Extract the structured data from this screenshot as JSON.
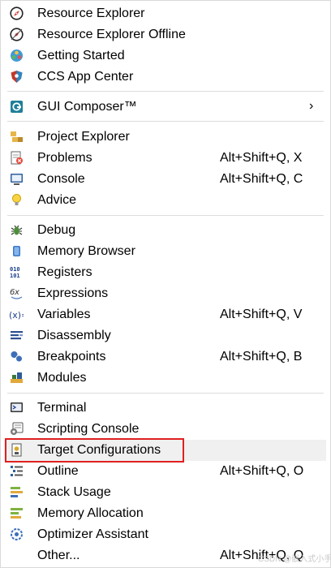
{
  "menu": {
    "items": [
      {
        "label": "Resource Explorer",
        "shortcut": "",
        "icon": "compass-icon"
      },
      {
        "label": "Resource Explorer Offline",
        "shortcut": "",
        "icon": "compass-offline-icon"
      },
      {
        "label": "Getting Started",
        "shortcut": "",
        "icon": "getting-started-icon"
      },
      {
        "label": "CCS App Center",
        "shortcut": "",
        "icon": "app-center-icon"
      },
      {
        "label": "GUI Composer™",
        "shortcut": "",
        "icon": "gui-composer-icon",
        "submenu": "›"
      },
      {
        "label": "Project Explorer",
        "shortcut": "",
        "icon": "project-explorer-icon"
      },
      {
        "label": "Problems",
        "shortcut": "Alt+Shift+Q, X",
        "icon": "problems-icon"
      },
      {
        "label": "Console",
        "shortcut": "Alt+Shift+Q, C",
        "icon": "console-icon"
      },
      {
        "label": "Advice",
        "shortcut": "",
        "icon": "lightbulb-icon"
      },
      {
        "label": "Debug",
        "shortcut": "",
        "icon": "debug-bug-icon"
      },
      {
        "label": "Memory Browser",
        "shortcut": "",
        "icon": "memory-cylinder-icon"
      },
      {
        "label": "Registers",
        "shortcut": "",
        "icon": "registers-icon"
      },
      {
        "label": "Expressions",
        "shortcut": "",
        "icon": "expressions-icon"
      },
      {
        "label": "Variables",
        "shortcut": "Alt+Shift+Q, V",
        "icon": "variables-icon"
      },
      {
        "label": "Disassembly",
        "shortcut": "",
        "icon": "disassembly-icon"
      },
      {
        "label": "Breakpoints",
        "shortcut": "Alt+Shift+Q, B",
        "icon": "breakpoints-icon"
      },
      {
        "label": "Modules",
        "shortcut": "",
        "icon": "modules-icon"
      },
      {
        "label": "Terminal",
        "shortcut": "",
        "icon": "terminal-icon"
      },
      {
        "label": "Scripting Console",
        "shortcut": "",
        "icon": "scripting-console-icon"
      },
      {
        "label": "Target Configurations",
        "shortcut": "",
        "icon": "target-config-icon"
      },
      {
        "label": "Outline",
        "shortcut": "Alt+Shift+Q, O",
        "icon": "outline-icon"
      },
      {
        "label": "Stack Usage",
        "shortcut": "",
        "icon": "stack-usage-icon"
      },
      {
        "label": "Memory Allocation",
        "shortcut": "",
        "icon": "memory-allocation-icon"
      },
      {
        "label": "Optimizer Assistant",
        "shortcut": "",
        "icon": "optimizer-icon"
      },
      {
        "label": "Other...",
        "shortcut": "Alt+Shift+Q, Q",
        "icon": ""
      }
    ]
  },
  "watermark": "CSDN @嵌入式小手套",
  "colors": {
    "highlight_border": "#e02020",
    "hover_bg": "#f0f0f0",
    "separator": "#dcdcdc"
  }
}
